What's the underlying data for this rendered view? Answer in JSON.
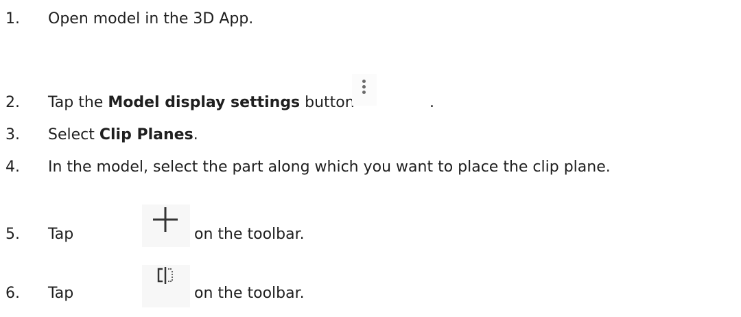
{
  "steps": [
    {
      "num": "1.",
      "text": "Open model in the 3D App."
    },
    {
      "num": "2.",
      "pre": "Tap the ",
      "bold": "Model display settings",
      "post": " button",
      "end": "."
    },
    {
      "num": "3.",
      "pre": "Select ",
      "bold": "Clip Planes",
      "post": "."
    },
    {
      "num": "4.",
      "text": "In the model, select the part along which you want to place the clip plane."
    },
    {
      "num": "5.",
      "pre": "Tap ",
      "post": "on the toolbar."
    },
    {
      "num": "6.",
      "pre": "Tap ",
      "post": "on the toolbar."
    }
  ],
  "icons": {
    "step2": "more-vertical-icon",
    "step5": "plus-icon",
    "step6": "clip-plane-icon"
  },
  "colors": {
    "text": "#1f1f1f",
    "icon": "#333333"
  }
}
